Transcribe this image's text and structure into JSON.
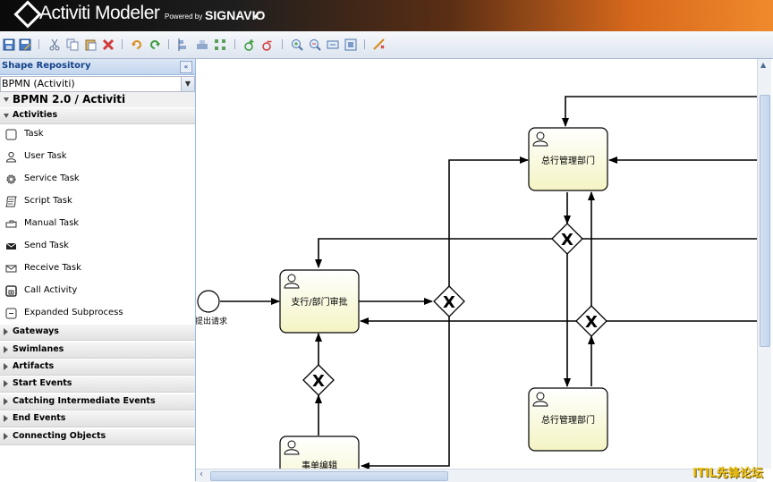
{
  "header": {
    "app_title": "Activiti Modeler",
    "powered_by": "Powered by",
    "brand": "SIGNAVIO"
  },
  "toolbar": {
    "icons": [
      "save-icon",
      "save-as-icon",
      "cut-icon",
      "copy-icon",
      "paste-icon",
      "delete-icon",
      "undo-icon",
      "redo-icon",
      "align-icon",
      "group-icon",
      "distribute-icon",
      "add-docker-icon",
      "remove-docker-icon",
      "zoom-in-icon",
      "zoom-out-icon",
      "zoom-standard-icon",
      "zoom-fit-icon",
      "validate-icon"
    ]
  },
  "sidebar": {
    "title": "Shape Repository",
    "collapse_glyph": "«",
    "stencil_set": "BPMN (Activiti)",
    "stencil_title": "BPMN 2.0 / Activiti",
    "activities_label": "Activities",
    "items": [
      {
        "label": "Task",
        "icon": "task-icon"
      },
      {
        "label": "User Task",
        "icon": "user-task-icon"
      },
      {
        "label": "Service Task",
        "icon": "service-task-icon"
      },
      {
        "label": "Script Task",
        "icon": "script-task-icon"
      },
      {
        "label": "Manual Task",
        "icon": "manual-task-icon"
      },
      {
        "label": "Send Task",
        "icon": "send-task-icon"
      },
      {
        "label": "Receive Task",
        "icon": "receive-task-icon"
      },
      {
        "label": "Call Activity",
        "icon": "call-activity-icon"
      },
      {
        "label": "Expanded Subprocess",
        "icon": "expanded-subprocess-icon"
      }
    ],
    "groups": [
      "Gateways",
      "Swimlanes",
      "Artifacts",
      "Start Events",
      "Catching Intermediate Events",
      "End Events",
      "Connecting Objects"
    ]
  },
  "diagram": {
    "start_event_label": "提出请求",
    "tasks": [
      {
        "id": "task_top",
        "label": "总行管理部门"
      },
      {
        "id": "task_mid",
        "label": "支行/部门审批"
      },
      {
        "id": "task_bottom_right",
        "label": "总行管理部门"
      },
      {
        "id": "task_bottom_left",
        "label": "事单编辑"
      }
    ],
    "gateway_symbol": "X"
  },
  "colors": {
    "task_fill": "#fbfbdc",
    "header_accent": "#ef8a2c",
    "panel_header": "#15428b"
  },
  "watermark": "ITIL先锋论坛"
}
